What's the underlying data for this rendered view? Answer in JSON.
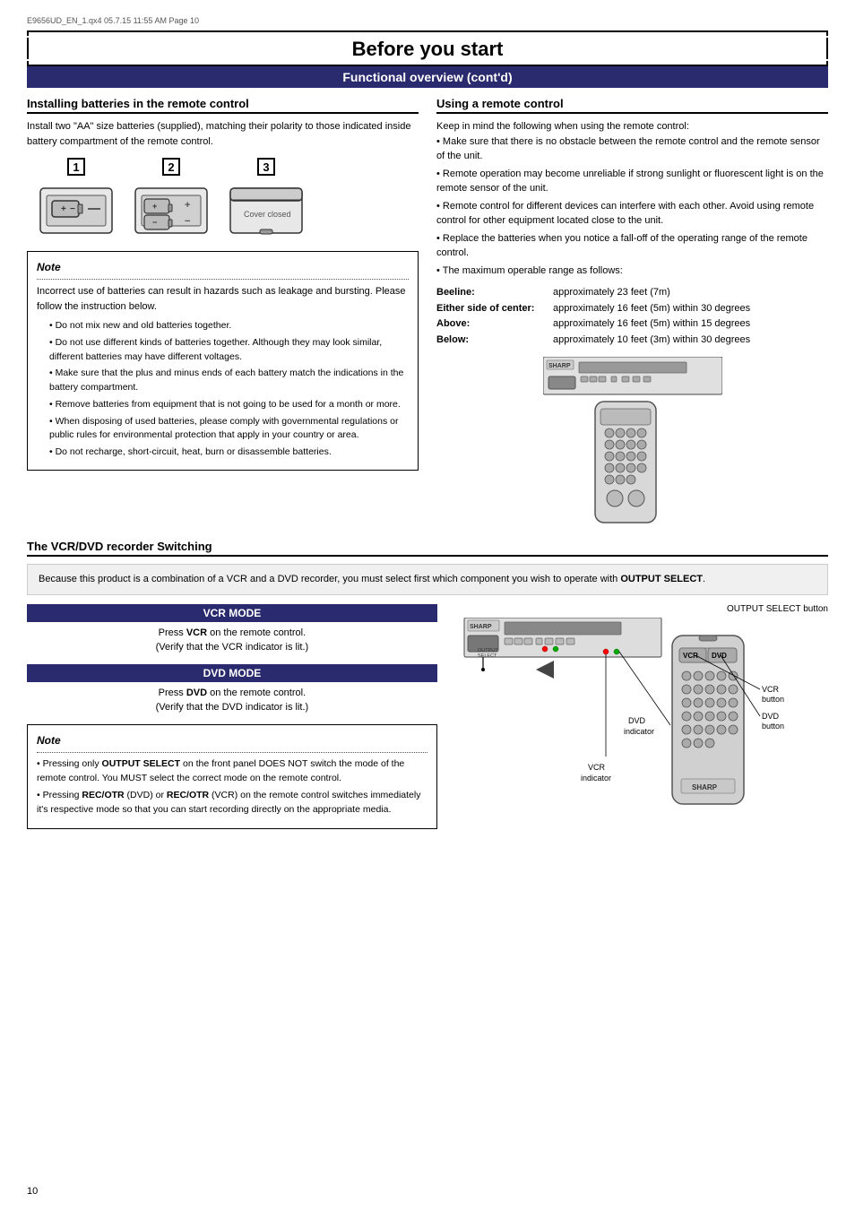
{
  "meta": {
    "file_info": "E9656UD_EN_1.qx4  05.7.15  11:55 AM  Page 10"
  },
  "page_title": "Before you start",
  "section_subtitle": "Functional overview (cont'd)",
  "left_column": {
    "title": "Installing batteries in the remote control",
    "intro": "Install two \"AA\" size batteries (supplied), matching their polarity to those indicated inside battery compartment of the remote control.",
    "steps": [
      "1",
      "2",
      "3"
    ],
    "note_title": "Note",
    "note_items": [
      "Incorrect use of batteries can result in hazards such as leakage and bursting. Please follow the instruction below.",
      "Do not mix new and old batteries together.",
      "Do not use different kinds of batteries together. Although they may look similar, different batteries may have different voltages.",
      "Make sure that the plus and minus ends of each battery match the indications in the battery compartment.",
      "Remove batteries from equipment that is not going to be used for a month or more.",
      "When disposing of used batteries, please comply with governmental regulations or public rules for environmental protection that apply in your country or area.",
      "Do not recharge, short-circuit, heat, burn or disassemble batteries."
    ]
  },
  "right_column": {
    "title": "Using a remote control",
    "intro": "Keep in mind the following when using the remote control:",
    "bullet_items": [
      "Make sure that there is no obstacle between the remote control and the remote sensor of the unit.",
      "Remote operation may become unreliable if strong sunlight or fluorescent light is on the remote sensor of the unit.",
      "Remote control for different devices can interfere with each other. Avoid using remote control for other equipment located close to the unit.",
      "Replace the batteries when you notice a fall-off of the operating range of the remote control.",
      "The maximum operable range as follows:"
    ],
    "range_rows": [
      {
        "label": "Beeline:",
        "value": "approximately 23 feet (7m)"
      },
      {
        "label": "Either side of center:",
        "value": "approximately 16 feet (5m) within 30 degrees"
      },
      {
        "label": "Above:",
        "value": "approximately 16 feet (5m) within 15 degrees"
      },
      {
        "label": "Below:",
        "value": "approximately 10 feet (3m) within 30 degrees"
      }
    ]
  },
  "bottom_section": {
    "title": "The VCR/DVD recorder Switching",
    "intro": "Because this product is a combination of a VCR and a DVD recorder, you must select first which component you wish to operate with OUTPUT SELECT.",
    "vcr_mode_title": "VCR MODE",
    "vcr_mode_desc": "Press VCR on the remote control. (Verify that the VCR indicator is lit.)",
    "dvd_mode_title": "DVD MODE",
    "dvd_mode_desc": "Press DVD on the remote control. (Verify that the DVD indicator is lit.)",
    "output_select_label": "OUTPUT SELECT button",
    "labels": {
      "vcr_button": "VCR button",
      "dvd_button": "DVD button",
      "dvd_indicator": "DVD indicator",
      "vcr_indicator": "VCR indicator"
    },
    "note_title": "Note",
    "note_items": [
      "Pressing only OUTPUT SELECT on the front panel DOES NOT switch the mode of the remote control. You MUST select the correct mode on the remote control.",
      "Pressing REC/OTR (DVD) or REC/OTR (VCR) on the remote control switches immediately it's respective mode so that you can start recording directly on the appropriate media."
    ]
  },
  "page_number": "10"
}
